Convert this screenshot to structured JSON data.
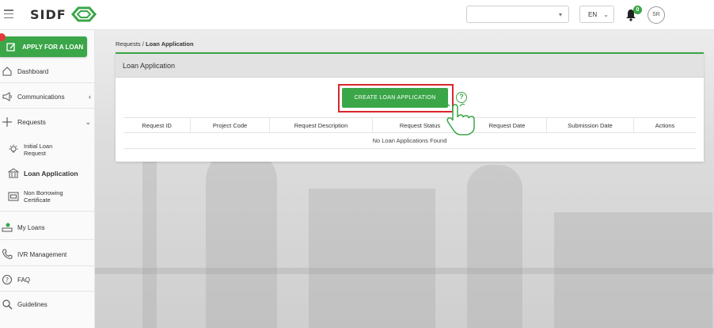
{
  "header": {
    "logo_text": "SIDF",
    "language": "EN",
    "notifications_count": "0",
    "user_initials": "SR",
    "org_select_value": ""
  },
  "sidebar": {
    "apply_label": "APPLY FOR A LOAN",
    "items": [
      {
        "label": "Dashboard",
        "icon": "home-icon"
      },
      {
        "label": "Communications",
        "icon": "megaphone-icon"
      },
      {
        "label": "Requests",
        "icon": "plus-icon"
      },
      {
        "label": "Initial Loan Request",
        "icon": "lightbulb-icon"
      },
      {
        "label": "Loan Application",
        "icon": "bank-icon"
      },
      {
        "label": "Non Borrowing Certificate",
        "icon": "certificate-icon"
      },
      {
        "label": "My Loans",
        "icon": "loans-icon"
      },
      {
        "label": "IVR Management",
        "icon": "phone-icon"
      },
      {
        "label": "FAQ",
        "icon": "question-icon"
      },
      {
        "label": "Guidelines",
        "icon": "search-icon"
      }
    ]
  },
  "breadcrumb": {
    "parent": "Requests",
    "separator": "/",
    "current": "Loan Application"
  },
  "card": {
    "title": "Loan Application",
    "create_button": "CREATE LOAN APPLICATION",
    "columns": [
      "Request ID",
      "Project Code",
      "Request Description",
      "Request Status",
      "Request Date",
      "Submission Date",
      "Actions"
    ],
    "empty_message": "No Loan Applications Found"
  },
  "colors": {
    "accent": "#3aa648",
    "highlight": "#d9262c",
    "badge_red": "#e23b3b"
  }
}
